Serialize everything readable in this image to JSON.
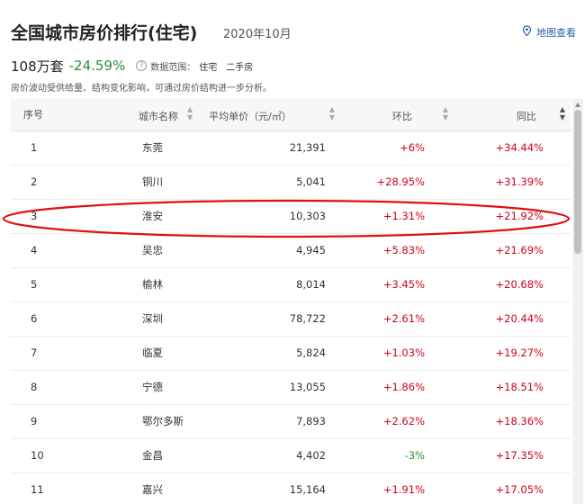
{
  "header": {
    "title": "全国城市房价排行(住宅)",
    "date": "2020年10月",
    "map_link": "地图查看"
  },
  "summary": {
    "total": "108万套",
    "change": "-24.59%",
    "scope_label": "数据范围：",
    "scope_values": "住宅　二手房",
    "note": "房价波动受供给量、结构变化影响，可通过房价结构进一步分析。"
  },
  "table": {
    "headers": [
      "序号",
      "城市名称",
      "平均单价（元/㎡）",
      "环比",
      "同比"
    ],
    "rows": [
      {
        "rank": "1",
        "city": "东莞",
        "price": "21,391",
        "mom": "+6%",
        "yoy": "+34.44%"
      },
      {
        "rank": "2",
        "city": "铜川",
        "price": "5,041",
        "mom": "+28.95%",
        "yoy": "+31.39%"
      },
      {
        "rank": "3",
        "city": "淮安",
        "price": "10,303",
        "mom": "+1.31%",
        "yoy": "+21.92%"
      },
      {
        "rank": "4",
        "city": "吴忠",
        "price": "4,945",
        "mom": "+5.83%",
        "yoy": "+21.69%"
      },
      {
        "rank": "5",
        "city": "榆林",
        "price": "8,014",
        "mom": "+3.45%",
        "yoy": "+20.68%"
      },
      {
        "rank": "6",
        "city": "深圳",
        "price": "78,722",
        "mom": "+2.61%",
        "yoy": "+20.44%"
      },
      {
        "rank": "7",
        "city": "临夏",
        "price": "5,824",
        "mom": "+1.03%",
        "yoy": "+19.27%"
      },
      {
        "rank": "8",
        "city": "宁德",
        "price": "13,055",
        "mom": "+1.86%",
        "yoy": "+18.51%"
      },
      {
        "rank": "9",
        "city": "鄂尔多斯",
        "price": "7,893",
        "mom": "+2.62%",
        "yoy": "+18.36%"
      },
      {
        "rank": "10",
        "city": "金昌",
        "price": "4,402",
        "mom": "-3%",
        "yoy": "+17.35%"
      },
      {
        "rank": "11",
        "city": "嘉兴",
        "price": "15,164",
        "mom": "+1.91%",
        "yoy": "+17.05%"
      }
    ]
  },
  "colors": {
    "positive": "#d0021b",
    "negative": "#2e8b3d",
    "highlight_ring": "#e01010",
    "link": "#2a5fa8"
  },
  "icons": {
    "map": "map-pin-icon",
    "help": "question-circle-icon",
    "sort": "sort-caret-icon"
  }
}
